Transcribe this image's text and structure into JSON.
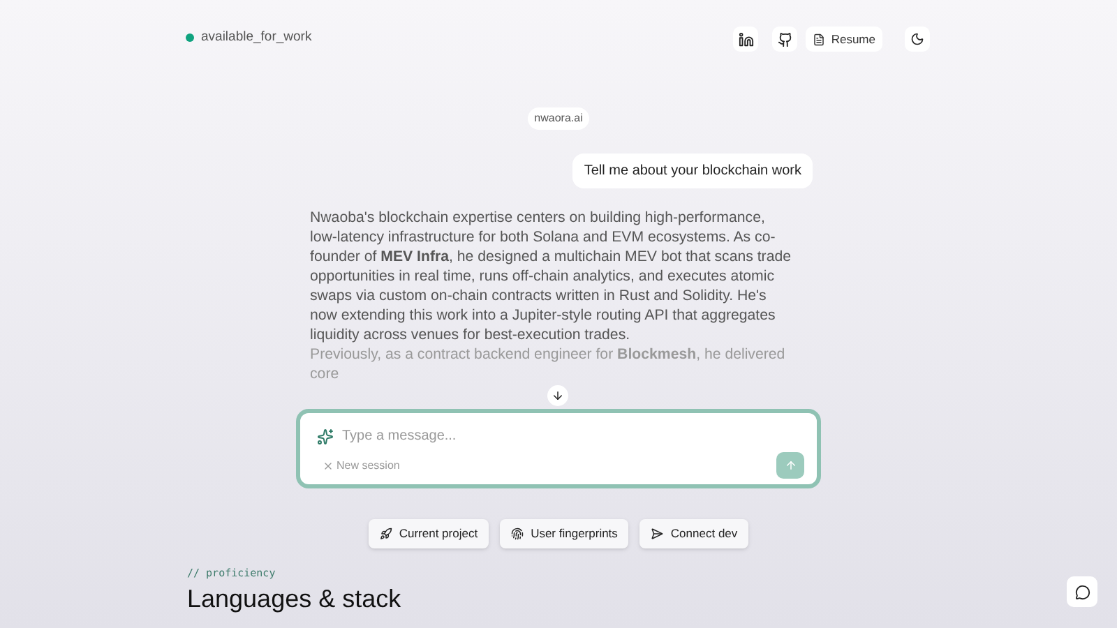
{
  "status": {
    "label": "available_for_work",
    "color": "#10a37f"
  },
  "header": {
    "resume": "Resume"
  },
  "chat": {
    "source": "nwaora.ai",
    "user_message": "Tell me about your blockchain work",
    "answer": [
      "Nwaoba's blockchain expertise centers on building high-performance, low-latency infrastructure for both Solana and EVM ecosystems. As co-founder of **MEV Infra**, he designed a multichain MEV bot that scans trade opportunities in real time, runs off-chain analytics, and executes atomic swaps via custom on-chain contracts written in Rust and Solidity. He's now extending this work into a Jupiter-style routing API that aggregates liquidity across venues for best-execution trades.",
      "Previously, as a contract backend engineer for **Blockmesh**, he delivered core"
    ]
  },
  "composer": {
    "placeholder": "Type a message...",
    "new_session": "New session"
  },
  "suggestions": [
    {
      "kind": "rocket",
      "label": "Current project"
    },
    {
      "kind": "fingerprint",
      "label": "User fingerprints"
    },
    {
      "kind": "send",
      "label": "Connect dev"
    }
  ],
  "section": {
    "eyebrow": "// proficiency",
    "title": "Languages & stack"
  }
}
